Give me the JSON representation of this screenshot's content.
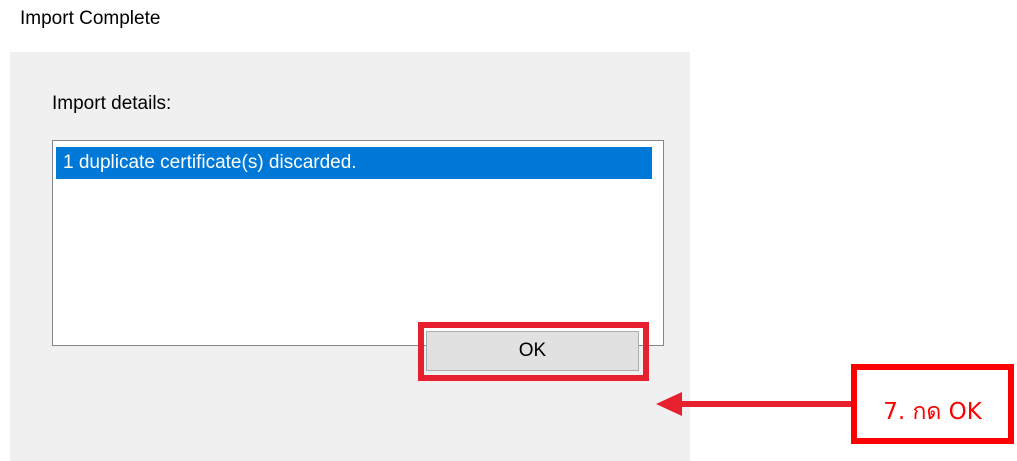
{
  "dialog": {
    "title": "Import Complete",
    "details_label": "Import details:",
    "details_items": [
      "1 duplicate certificate(s) discarded."
    ],
    "ok_label": "OK"
  },
  "annotation": {
    "text": "7. กด OK",
    "color": "#ff0000"
  },
  "colors": {
    "selection": "#0078d7",
    "dialog_background": "#f0f0f0",
    "highlight_border": "#e6202e"
  },
  "icons": {
    "pointer": "left-arrow-icon"
  }
}
